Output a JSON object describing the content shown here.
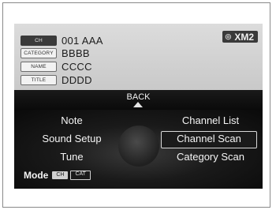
{
  "info": {
    "channel": {
      "tag": "CH",
      "value": "001 AAA"
    },
    "category": {
      "tag": "CATEGORY",
      "value": "BBBB"
    },
    "name": {
      "tag": "NAME",
      "value": "CCCC"
    },
    "title": {
      "tag": "TITLE",
      "value": "DDDD"
    },
    "band": "XM2"
  },
  "back": {
    "label": "BACK"
  },
  "menu": {
    "left": [
      "Note",
      "Sound Setup",
      "Tune"
    ],
    "right": [
      "Channel List",
      "Channel Scan",
      "Category Scan"
    ],
    "selected": "Channel Scan"
  },
  "mode": {
    "label": "Mode",
    "options": [
      "CH",
      "CAT"
    ],
    "active": "CH"
  },
  "colors": {
    "screen_bg": "#0d0d0d",
    "info_bg": "#d3d3d3",
    "text_light": "#f4f4f4"
  }
}
